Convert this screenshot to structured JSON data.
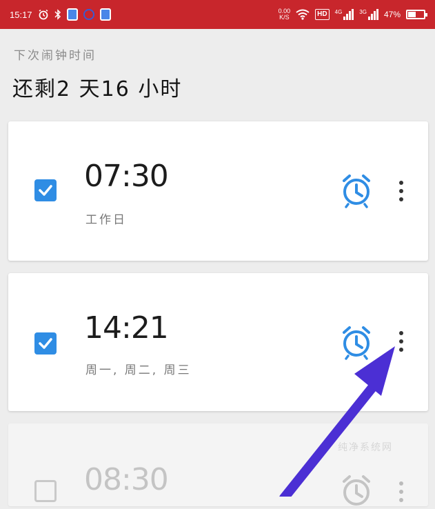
{
  "status_bar": {
    "time": "15:17",
    "net_speed_top": "0.00",
    "net_speed_bottom": "K/S",
    "hd_label": "HD",
    "signal1_tag": "4G",
    "signal2_tag": "3G",
    "battery_text": "47%",
    "battery_level": 0.47,
    "bg_color": "#c8262c"
  },
  "header": {
    "label": "下次闹钟时间",
    "remaining": "还剩2 天16 小时"
  },
  "alarms": [
    {
      "time": "07:30",
      "repeat": "工作日",
      "enabled": true,
      "alarm_icon": "alarm-clock-icon",
      "menu_icon": "more-vert-icon"
    },
    {
      "time": "14:21",
      "repeat": "周一, 周二, 周三",
      "enabled": true,
      "alarm_icon": "alarm-clock-icon",
      "menu_icon": "more-vert-icon"
    },
    {
      "time": "08:30",
      "repeat": "",
      "enabled": false,
      "alarm_icon": "alarm-clock-icon",
      "menu_icon": "more-vert-icon"
    }
  ],
  "colors": {
    "accent": "#2f8de4",
    "arrow": "#4b2fd4"
  },
  "watermark": "纯净系统网"
}
